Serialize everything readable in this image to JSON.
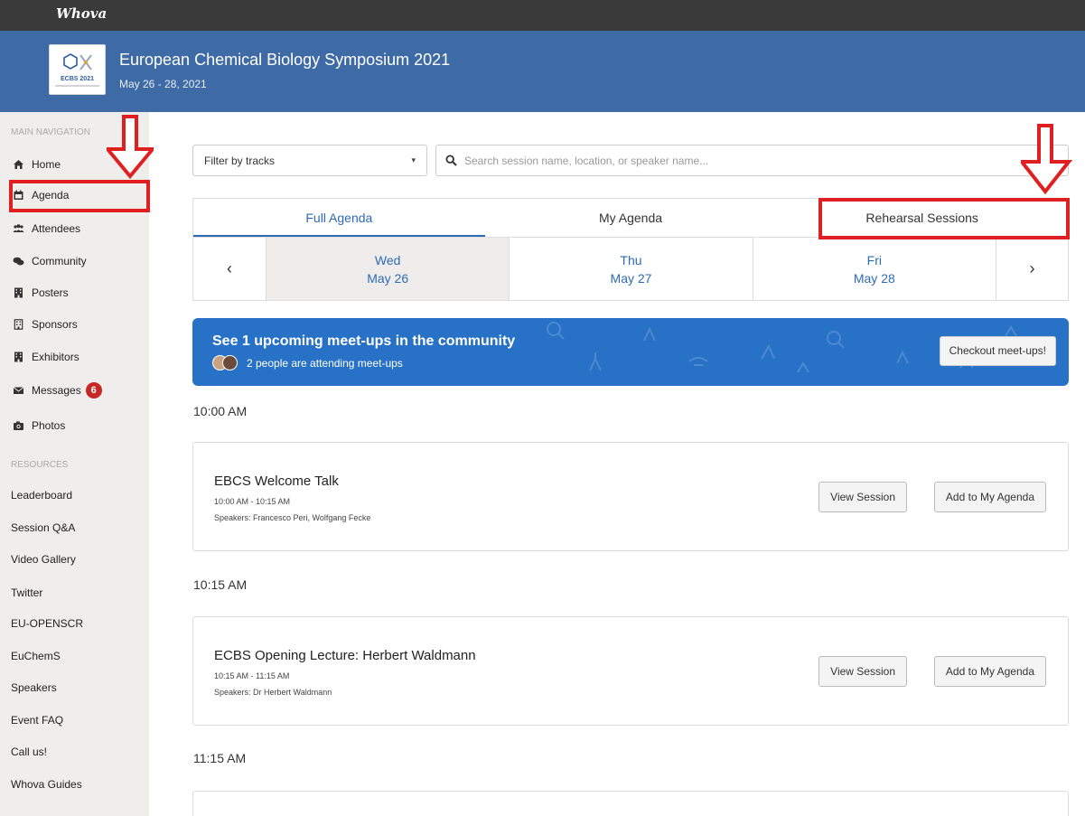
{
  "app": {
    "brand": "Whova"
  },
  "event": {
    "title": "European Chemical Biology Symposium 2021",
    "dates": "May 26 - 28, 2021",
    "logo_caption": "ECBS 2021"
  },
  "sidebar": {
    "main_header": "MAIN NAVIGATION",
    "items": [
      {
        "label": "Home",
        "icon": "home-icon"
      },
      {
        "label": "Agenda",
        "icon": "calendar-icon"
      },
      {
        "label": "Attendees",
        "icon": "users-icon"
      },
      {
        "label": "Community",
        "icon": "chat-icon"
      },
      {
        "label": "Posters",
        "icon": "building-icon"
      },
      {
        "label": "Sponsors",
        "icon": "building-icon"
      },
      {
        "label": "Exhibitors",
        "icon": "building-icon"
      },
      {
        "label": "Messages",
        "icon": "envelope-icon",
        "badge": "6"
      },
      {
        "label": "Photos",
        "icon": "camera-icon"
      }
    ],
    "resources_header": "RESOURCES",
    "resources": [
      "Leaderboard",
      "Session Q&A",
      "Video Gallery",
      "Twitter",
      "EU-OPENSCR",
      "EuChemS",
      "Speakers",
      "Event FAQ",
      "Call us!",
      "Whova Guides"
    ]
  },
  "filter": {
    "label": "Filter by tracks"
  },
  "search": {
    "placeholder": "Search session name, location, or speaker name..."
  },
  "tabs": [
    {
      "label": "Full Agenda",
      "active": true
    },
    {
      "label": "My Agenda",
      "active": false
    },
    {
      "label": "Rehearsal Sessions",
      "active": false
    }
  ],
  "days": [
    {
      "weekday": "Wed",
      "date": "May 26",
      "selected": true
    },
    {
      "weekday": "Thu",
      "date": "May 27",
      "selected": false
    },
    {
      "weekday": "Fri",
      "date": "May 28",
      "selected": false
    }
  ],
  "banner": {
    "title": "See 1 upcoming meet-ups in the community",
    "subtitle": "2 people are attending meet-ups",
    "button": "Checkout meet-ups!"
  },
  "schedule": [
    {
      "time": "10:00 AM",
      "session": {
        "title": "EBCS Welcome Talk",
        "time_range": "10:00 AM - 10:15 AM",
        "speakers": "Speakers: Francesco Peri, Wolfgang Fecke"
      }
    },
    {
      "time": "10:15 AM",
      "session": {
        "title": "ECBS Opening Lecture: Herbert Waldmann",
        "time_range": "10:15 AM - 11:15 AM",
        "speakers": "Speakers: Dr Herbert Waldmann"
      }
    },
    {
      "time": "11:15 AM"
    }
  ],
  "buttons": {
    "view_session": "View Session",
    "add_agenda": "Add to My Agenda"
  },
  "colors": {
    "accent": "#2d6bb5",
    "header": "#3e6aa6",
    "annotation": "#e02020",
    "badge": "#c62828"
  }
}
